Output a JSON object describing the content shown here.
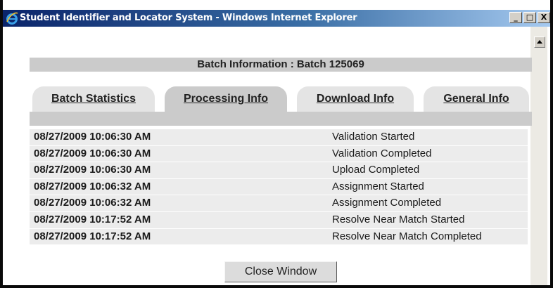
{
  "window": {
    "title": "Student Identifier and Locator System - Windows Internet Explorer",
    "minimize_label": "_",
    "maximize_label": "□",
    "close_label": "X"
  },
  "batch": {
    "header": "Batch Information : Batch 125069"
  },
  "tabs": [
    {
      "label": "Batch Statistics",
      "active": false
    },
    {
      "label": "Processing Info",
      "active": true
    },
    {
      "label": "Download Info",
      "active": false
    },
    {
      "label": "General Info",
      "active": false
    }
  ],
  "events": [
    {
      "timestamp": "08/27/2009 10:06:30 AM",
      "event": "Validation Started"
    },
    {
      "timestamp": "08/27/2009 10:06:30 AM",
      "event": "Validation Completed"
    },
    {
      "timestamp": "08/27/2009 10:06:30 AM",
      "event": "Upload Completed"
    },
    {
      "timestamp": "08/27/2009 10:06:32 AM",
      "event": "Assignment Started"
    },
    {
      "timestamp": "08/27/2009 10:06:32 AM",
      "event": "Assignment Completed"
    },
    {
      "timestamp": "08/27/2009 10:17:52 AM",
      "event": "Resolve Near Match Started"
    },
    {
      "timestamp": "08/27/2009 10:17:52 AM",
      "event": "Resolve Near Match Completed"
    }
  ],
  "close_button": {
    "label": "Close Window"
  },
  "colors": {
    "titlebar_start": "#0a246a",
    "titlebar_end": "#a6caf0",
    "header_bg": "#cbcbcb",
    "row_bg": "#ececec",
    "inactive_tab_bg": "#e4e4e4"
  },
  "icons": {
    "app": "internet-explorer-icon"
  }
}
